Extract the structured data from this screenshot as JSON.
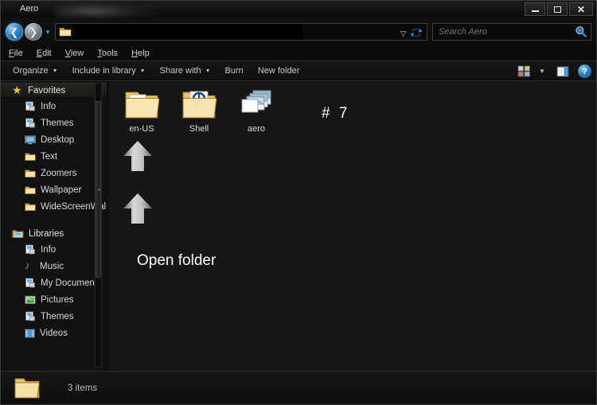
{
  "window": {
    "title": "Aero",
    "controls": {
      "minimize_label": "Minimize",
      "maximize_label": "Maximize",
      "close_label": "Close"
    }
  },
  "addressbar": {
    "back_label": "Back",
    "forward_label": "Forward",
    "history_caret": "▼",
    "crumb_separator": "▶",
    "path_redacted": true,
    "dropdown_caret": "▽",
    "refresh_label": "Refresh",
    "folder_icon": "folder-icon"
  },
  "search": {
    "placeholder": "Search Aero",
    "value": "",
    "icon": "search-icon"
  },
  "menubar": {
    "items": [
      {
        "label": "File",
        "accesskey": "F"
      },
      {
        "label": "Edit",
        "accesskey": "E"
      },
      {
        "label": "View",
        "accesskey": "V"
      },
      {
        "label": "Tools",
        "accesskey": "T"
      },
      {
        "label": "Help",
        "accesskey": "H"
      }
    ]
  },
  "toolbar": {
    "buttons": [
      {
        "label": "Organize",
        "has_caret": true
      },
      {
        "label": "Include in library",
        "has_caret": true
      },
      {
        "label": "Share with",
        "has_caret": true
      },
      {
        "label": "Burn",
        "has_caret": false
      },
      {
        "label": "New folder",
        "has_caret": false
      }
    ],
    "caret": "▼",
    "view_icon": "view-options-icon",
    "view_caret": "▼",
    "preview_icon": "preview-pane-icon",
    "help_icon": "help-icon",
    "help_glyph": "?"
  },
  "sidebar": {
    "groups": [
      {
        "header": "Favorites",
        "header_icon": "star-icon",
        "items": [
          {
            "label": "Info",
            "icon": "document-icon"
          },
          {
            "label": "Themes",
            "icon": "document-icon"
          },
          {
            "label": "Desktop",
            "icon": "monitor-icon"
          },
          {
            "label": "Text",
            "icon": "folder-icon"
          },
          {
            "label": "Zoomers",
            "icon": "folder-icon"
          },
          {
            "label": "Wallpaper",
            "icon": "folder-icon"
          },
          {
            "label": "WideScreenWal",
            "icon": "folder-icon"
          }
        ]
      },
      {
        "header": "Libraries",
        "header_icon": "library-icon",
        "items": [
          {
            "label": "Info",
            "icon": "document-icon"
          },
          {
            "label": "Music",
            "icon": "music-note-icon"
          },
          {
            "label": "My Documents",
            "icon": "document-icon"
          },
          {
            "label": "Pictures",
            "icon": "picture-icon"
          },
          {
            "label": "Themes",
            "icon": "document-icon"
          },
          {
            "label": "Videos",
            "icon": "video-icon"
          }
        ]
      }
    ],
    "scrollbar": "vertical-scrollbar"
  },
  "content": {
    "files": [
      {
        "label": "en-US",
        "icon": "folder-icon"
      },
      {
        "label": "Shell",
        "icon": "folder-with-peace-logo-icon"
      },
      {
        "label": "aero",
        "icon": "image-stack-icon"
      }
    ],
    "annotations": {
      "hash_seven": "#  7",
      "open_folder": "Open folder",
      "arrows": [
        "up-arrow-annotation",
        "up-arrow-annotation"
      ]
    }
  },
  "statusbar": {
    "item_count": "3 items",
    "folder_icon": "large-folder-icon"
  },
  "colors": {
    "window_bg": "#0d0d0d",
    "content_bg": "#161616",
    "sidebar_bg": "#111111",
    "text": "#d8d8d8",
    "accent_blue": "#2f7fc2",
    "folder_yellow": "#f2d27a",
    "star_yellow": "#f2c230"
  }
}
